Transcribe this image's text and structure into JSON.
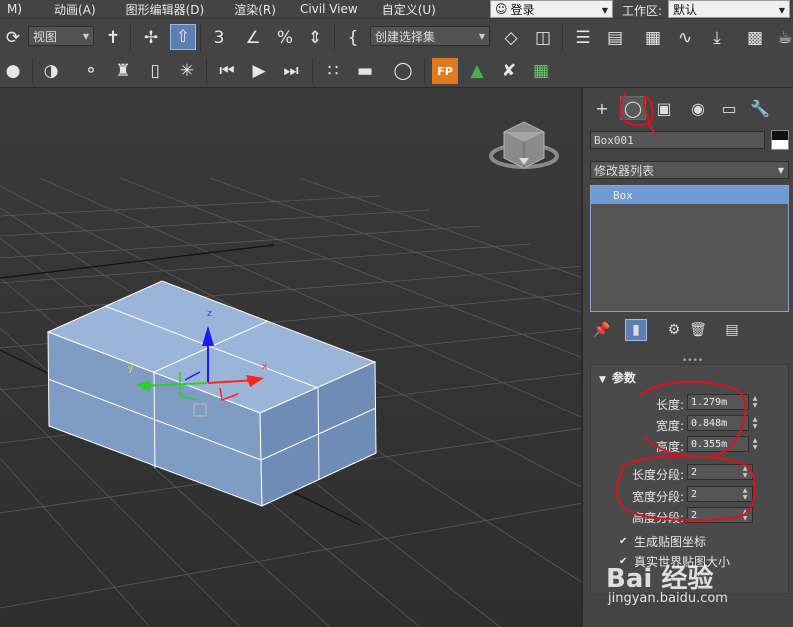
{
  "menubar": {
    "items": [
      "M)",
      "动画(A)",
      "图形编辑器(D)",
      "渲染(R)",
      "Civil View",
      "自定义(U)"
    ],
    "login": "登录",
    "workspace_label": "工作区:",
    "workspace_value": "默认"
  },
  "toolbar": {
    "view_combo": "视图",
    "selection_set_combo": "创建选择集"
  },
  "command_panel": {
    "object_name": "Box001",
    "modifier_list": "修改器列表",
    "stack_item": "Box",
    "rollout_title": "参数",
    "params": [
      {
        "label": "长度:",
        "value": "1.279m"
      },
      {
        "label": "宽度:",
        "value": "0.848m"
      },
      {
        "label": "高度:",
        "value": "0.355m"
      }
    ],
    "segments": [
      {
        "label": "长度分段:",
        "value": "2"
      },
      {
        "label": "宽度分段:",
        "value": "2"
      },
      {
        "label": "高度分段:",
        "value": "2"
      }
    ],
    "checkboxes": [
      "生成贴图坐标",
      "真实世界贴图大小"
    ]
  },
  "viewport": {
    "gizmo_labels": {
      "x": "x",
      "y": "y",
      "z": "z"
    }
  },
  "watermark": {
    "logo": "Bai 经验",
    "url": "jingyan.baidu.com"
  },
  "colors": {
    "background": "#444444",
    "box_face": "#8eaad0",
    "selection_blue": "#6f9bd4",
    "annotation_red": "#e0101a"
  }
}
